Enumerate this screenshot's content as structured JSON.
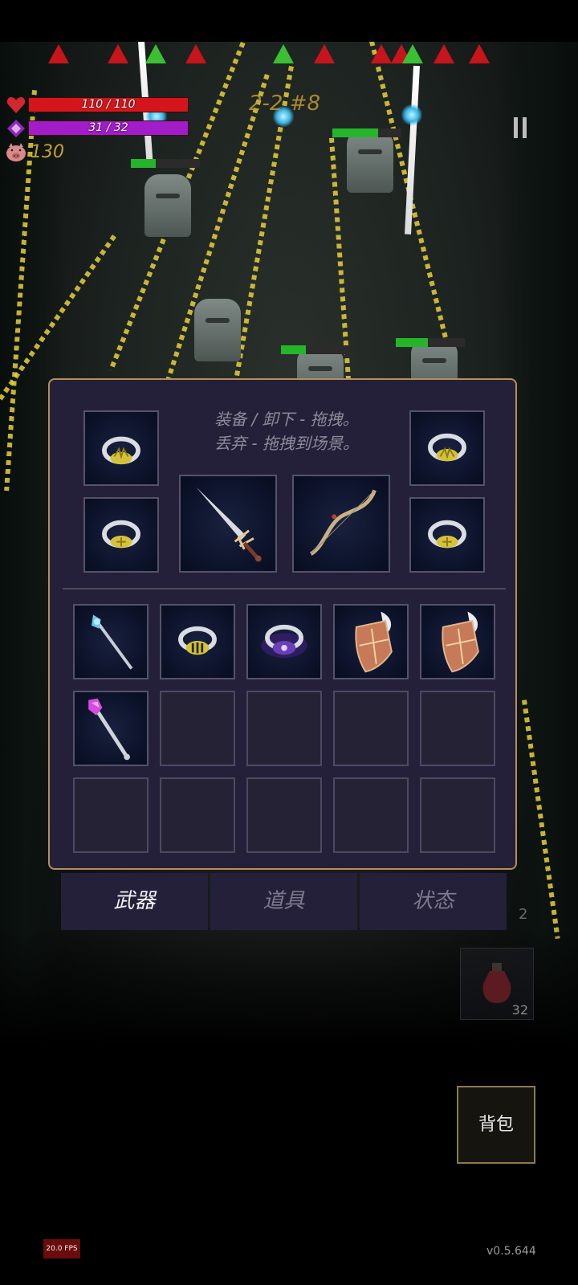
{
  "hud": {
    "hp_text": "110 / 110",
    "hp_value": 110,
    "hp_max": 110,
    "mp_text": "31 / 32",
    "mp_value": 31,
    "mp_max": 32,
    "coins": "130",
    "level": "2-2 #8"
  },
  "panel": {
    "hint_line1": "装备 / 卸下 - 拖拽。",
    "hint_line2": "丢弃 - 拖拽到场景。",
    "equipped": [
      {
        "item": "gold-ring"
      },
      {
        "item": "gold-ring"
      },
      {
        "item": "sword"
      },
      {
        "item": "bow"
      },
      {
        "item": "gold-ring"
      },
      {
        "item": "gold-ring"
      }
    ],
    "inventory": [
      {
        "item": "crystal-staff"
      },
      {
        "item": "striped-ring"
      },
      {
        "item": "purple-ring"
      },
      {
        "item": "winged-shield"
      },
      {
        "item": "winged-shield"
      },
      {
        "item": "pink-crystal-staff"
      },
      {
        "item": ""
      },
      {
        "item": ""
      },
      {
        "item": ""
      },
      {
        "item": ""
      },
      {
        "item": ""
      },
      {
        "item": ""
      },
      {
        "item": ""
      },
      {
        "item": ""
      },
      {
        "item": ""
      }
    ]
  },
  "tabs": [
    {
      "label": "武器",
      "active": true
    },
    {
      "label": "道具",
      "active": false
    },
    {
      "label": "状态",
      "active": false
    }
  ],
  "side_counter": "2",
  "potion_count": "32",
  "bag_label": "背包",
  "fps": "20.0 FPS",
  "version": "v0.5.644",
  "colors": {
    "hp": "#d4161c",
    "mp": "#a21dc9",
    "panel_bg": "#24203a",
    "panel_border": "#b58e5a",
    "enemy_hp": "#25b52b"
  }
}
